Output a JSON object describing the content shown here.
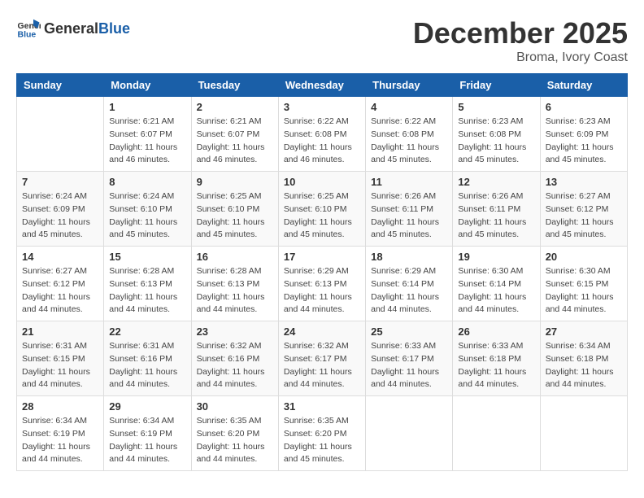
{
  "logo": {
    "general": "General",
    "blue": "Blue"
  },
  "title": "December 2025",
  "location": "Broma, Ivory Coast",
  "weekdays": [
    "Sunday",
    "Monday",
    "Tuesday",
    "Wednesday",
    "Thursday",
    "Friday",
    "Saturday"
  ],
  "weeks": [
    [
      {
        "day": null,
        "info": null
      },
      {
        "day": "1",
        "info": "Sunrise: 6:21 AM\nSunset: 6:07 PM\nDaylight: 11 hours\nand 46 minutes."
      },
      {
        "day": "2",
        "info": "Sunrise: 6:21 AM\nSunset: 6:07 PM\nDaylight: 11 hours\nand 46 minutes."
      },
      {
        "day": "3",
        "info": "Sunrise: 6:22 AM\nSunset: 6:08 PM\nDaylight: 11 hours\nand 46 minutes."
      },
      {
        "day": "4",
        "info": "Sunrise: 6:22 AM\nSunset: 6:08 PM\nDaylight: 11 hours\nand 45 minutes."
      },
      {
        "day": "5",
        "info": "Sunrise: 6:23 AM\nSunset: 6:08 PM\nDaylight: 11 hours\nand 45 minutes."
      },
      {
        "day": "6",
        "info": "Sunrise: 6:23 AM\nSunset: 6:09 PM\nDaylight: 11 hours\nand 45 minutes."
      }
    ],
    [
      {
        "day": "7",
        "info": "Sunrise: 6:24 AM\nSunset: 6:09 PM\nDaylight: 11 hours\nand 45 minutes."
      },
      {
        "day": "8",
        "info": "Sunrise: 6:24 AM\nSunset: 6:10 PM\nDaylight: 11 hours\nand 45 minutes."
      },
      {
        "day": "9",
        "info": "Sunrise: 6:25 AM\nSunset: 6:10 PM\nDaylight: 11 hours\nand 45 minutes."
      },
      {
        "day": "10",
        "info": "Sunrise: 6:25 AM\nSunset: 6:10 PM\nDaylight: 11 hours\nand 45 minutes."
      },
      {
        "day": "11",
        "info": "Sunrise: 6:26 AM\nSunset: 6:11 PM\nDaylight: 11 hours\nand 45 minutes."
      },
      {
        "day": "12",
        "info": "Sunrise: 6:26 AM\nSunset: 6:11 PM\nDaylight: 11 hours\nand 45 minutes."
      },
      {
        "day": "13",
        "info": "Sunrise: 6:27 AM\nSunset: 6:12 PM\nDaylight: 11 hours\nand 45 minutes."
      }
    ],
    [
      {
        "day": "14",
        "info": "Sunrise: 6:27 AM\nSunset: 6:12 PM\nDaylight: 11 hours\nand 44 minutes."
      },
      {
        "day": "15",
        "info": "Sunrise: 6:28 AM\nSunset: 6:13 PM\nDaylight: 11 hours\nand 44 minutes."
      },
      {
        "day": "16",
        "info": "Sunrise: 6:28 AM\nSunset: 6:13 PM\nDaylight: 11 hours\nand 44 minutes."
      },
      {
        "day": "17",
        "info": "Sunrise: 6:29 AM\nSunset: 6:13 PM\nDaylight: 11 hours\nand 44 minutes."
      },
      {
        "day": "18",
        "info": "Sunrise: 6:29 AM\nSunset: 6:14 PM\nDaylight: 11 hours\nand 44 minutes."
      },
      {
        "day": "19",
        "info": "Sunrise: 6:30 AM\nSunset: 6:14 PM\nDaylight: 11 hours\nand 44 minutes."
      },
      {
        "day": "20",
        "info": "Sunrise: 6:30 AM\nSunset: 6:15 PM\nDaylight: 11 hours\nand 44 minutes."
      }
    ],
    [
      {
        "day": "21",
        "info": "Sunrise: 6:31 AM\nSunset: 6:15 PM\nDaylight: 11 hours\nand 44 minutes."
      },
      {
        "day": "22",
        "info": "Sunrise: 6:31 AM\nSunset: 6:16 PM\nDaylight: 11 hours\nand 44 minutes."
      },
      {
        "day": "23",
        "info": "Sunrise: 6:32 AM\nSunset: 6:16 PM\nDaylight: 11 hours\nand 44 minutes."
      },
      {
        "day": "24",
        "info": "Sunrise: 6:32 AM\nSunset: 6:17 PM\nDaylight: 11 hours\nand 44 minutes."
      },
      {
        "day": "25",
        "info": "Sunrise: 6:33 AM\nSunset: 6:17 PM\nDaylight: 11 hours\nand 44 minutes."
      },
      {
        "day": "26",
        "info": "Sunrise: 6:33 AM\nSunset: 6:18 PM\nDaylight: 11 hours\nand 44 minutes."
      },
      {
        "day": "27",
        "info": "Sunrise: 6:34 AM\nSunset: 6:18 PM\nDaylight: 11 hours\nand 44 minutes."
      }
    ],
    [
      {
        "day": "28",
        "info": "Sunrise: 6:34 AM\nSunset: 6:19 PM\nDaylight: 11 hours\nand 44 minutes."
      },
      {
        "day": "29",
        "info": "Sunrise: 6:34 AM\nSunset: 6:19 PM\nDaylight: 11 hours\nand 44 minutes."
      },
      {
        "day": "30",
        "info": "Sunrise: 6:35 AM\nSunset: 6:20 PM\nDaylight: 11 hours\nand 44 minutes."
      },
      {
        "day": "31",
        "info": "Sunrise: 6:35 AM\nSunset: 6:20 PM\nDaylight: 11 hours\nand 45 minutes."
      },
      {
        "day": null,
        "info": null
      },
      {
        "day": null,
        "info": null
      },
      {
        "day": null,
        "info": null
      }
    ]
  ]
}
